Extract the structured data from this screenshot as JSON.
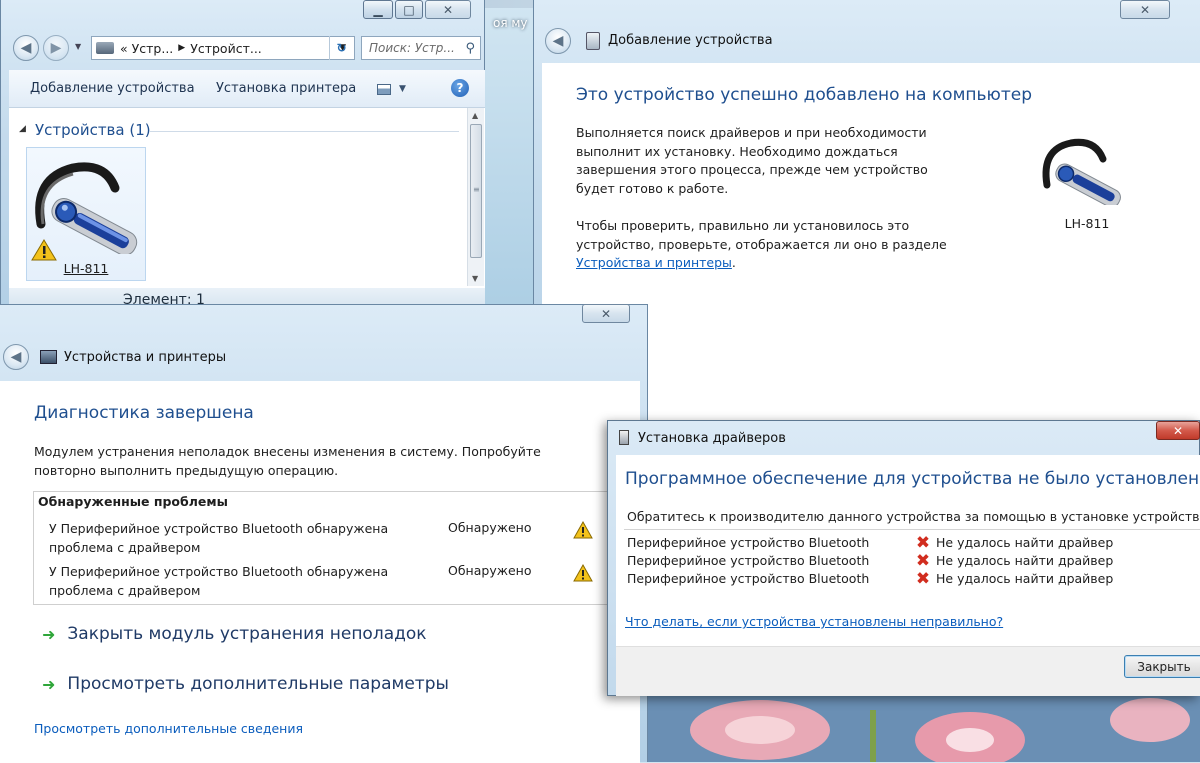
{
  "explorer": {
    "breadcrumb": [
      "Устр...",
      "Устройст..."
    ],
    "search_placeholder": "Поиск: Устр...",
    "toolbar": {
      "add_device": "Добавление устройства",
      "add_printer": "Установка принтера"
    },
    "group_header": "Устройства (1)",
    "device_name": "LH-811",
    "status_text": "Элемент: 1"
  },
  "bg_label": "оя му",
  "add_device": {
    "title": "Добавление устройства",
    "heading": "Это устройство успешно добавлено на компьютер",
    "para1": "Выполняется поиск драйверов и при необходимости выполнит их установку. Необходимо дождаться завершения этого процесса, прежде чем устройство будет готово к работе.",
    "para2_prefix": "Чтобы проверить, правильно ли установилось это устройство, проверьте, отображается ли оно в разделе ",
    "para2_link": "Устройства и принтеры",
    "para2_suffix": ".",
    "device_name": "LH-811"
  },
  "troubleshoot": {
    "title": "Устройства и принтеры",
    "heading": "Диагностика завершена",
    "description": "Модулем устранения неполадок внесены изменения в систему. Попробуйте повторно выполнить предыдущую операцию.",
    "problems_header": "Обнаруженные проблемы",
    "problems": [
      {
        "text": "У Периферийное устройство Bluetooth обнаружена проблема с драйвером",
        "status": "Обнаружено"
      },
      {
        "text": "У Периферийное устройство Bluetooth обнаружена проблема с драйвером",
        "status": "Обнаружено"
      }
    ],
    "action_close": "Закрыть модуль устранения неполадок",
    "action_more": "Просмотреть дополнительные параметры",
    "details_link": "Просмотреть дополнительные сведения"
  },
  "driver": {
    "title": "Установка драйверов",
    "heading": "Программное обеспечение для устройства не было установлено",
    "info": "Обратитесь к производителю данного устройства за помощью в установке устройства.",
    "items": [
      {
        "device": "Периферийное устройство Bluetooth",
        "status": "Не удалось найти драйвер"
      },
      {
        "device": "Периферийное устройство Bluetooth",
        "status": "Не удалось найти драйвер"
      },
      {
        "device": "Периферийное устройство Bluetooth",
        "status": "Не удалось найти драйвер"
      }
    ],
    "help_link": "Что делать, если устройства установлены неправильно?",
    "close_button": "Закрыть"
  }
}
